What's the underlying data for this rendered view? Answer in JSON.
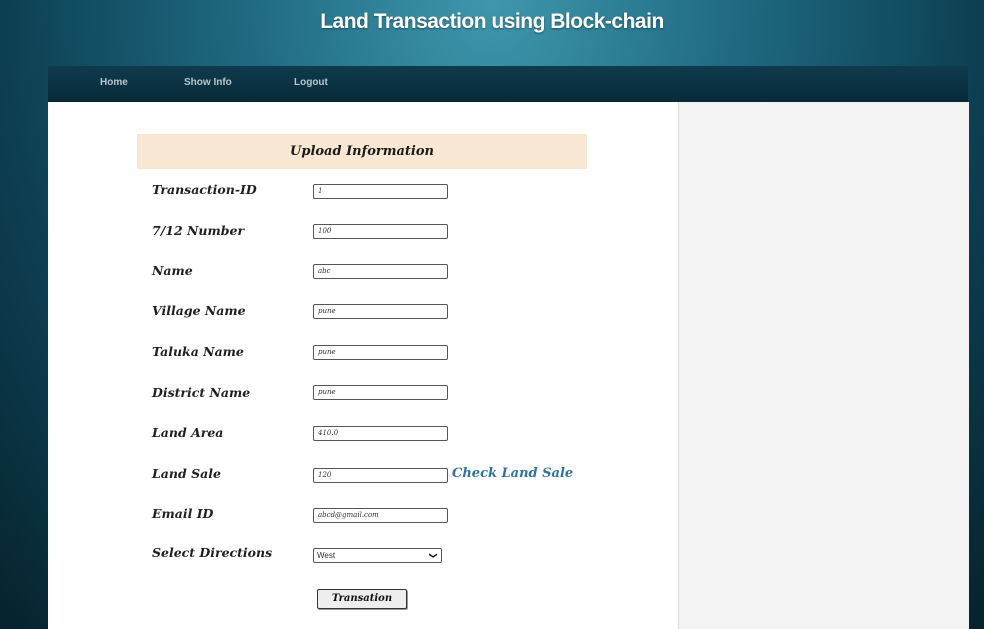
{
  "header": {
    "title": "Land Transaction using Block-chain"
  },
  "nav": {
    "items": [
      "Home",
      "Show Info",
      "Logout"
    ]
  },
  "form": {
    "heading": "Upload Information",
    "fields": [
      {
        "label": "Transaction-ID",
        "value": "1"
      },
      {
        "label": "7/12 Number",
        "value": "100"
      },
      {
        "label": "Name",
        "value": "abc"
      },
      {
        "label": "Village Name",
        "value": "pune"
      },
      {
        "label": "Taluka Name",
        "value": "pune"
      },
      {
        "label": "District Name",
        "value": "pune"
      },
      {
        "label": "Land Area",
        "value": "410.0"
      },
      {
        "label": "Land Sale",
        "value": "120"
      },
      {
        "label": "Email ID",
        "value": "abcd@gmail.com"
      }
    ],
    "directions": {
      "label": "Select Directions",
      "selected": "West"
    },
    "check_link": "Check Land Sale",
    "submit_label": "Transation"
  },
  "icons": {
    "select_arrow": "chevron-down-icon"
  },
  "colors": {
    "nav_bg": "#0b3545",
    "header_bg": "#f8e8d3",
    "link": "#2f73a2"
  }
}
